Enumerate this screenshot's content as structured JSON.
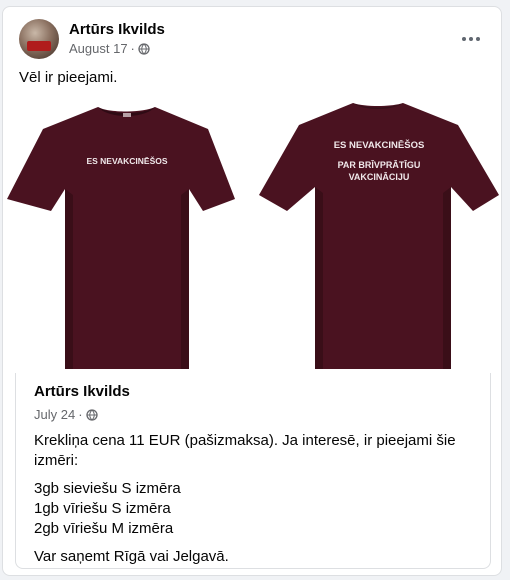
{
  "post": {
    "author": "Artūrs Ikvilds",
    "date": "August 17",
    "separator": "·",
    "privacy_icon": "globe-icon",
    "text": "Vēl ir pieejami."
  },
  "photo": {
    "front_print": "ES NEVAKCINĒŠOS",
    "back_print_line1": "ES NEVAKCINĒŠOS",
    "back_print_line2": "PAR BRĪVPRĀTĪGU",
    "back_print_line3": "VAKCINĀCIJU",
    "shirt_color": "#4a1220"
  },
  "shared_post": {
    "author": "Artūrs Ikvilds",
    "date": "July 24",
    "separator": "·",
    "intro": "Krekliņa cena 11 EUR (pašizmaksa).  Ja interesē, ir pieejami šie izmēri:",
    "sizes": [
      "3gb sieviešu S izmēra",
      "1gb  vīriešu S izmēra",
      "2gb vīriešu M izmēra"
    ],
    "pickup": "Var saņemt Rīgā vai Jelgavā."
  }
}
